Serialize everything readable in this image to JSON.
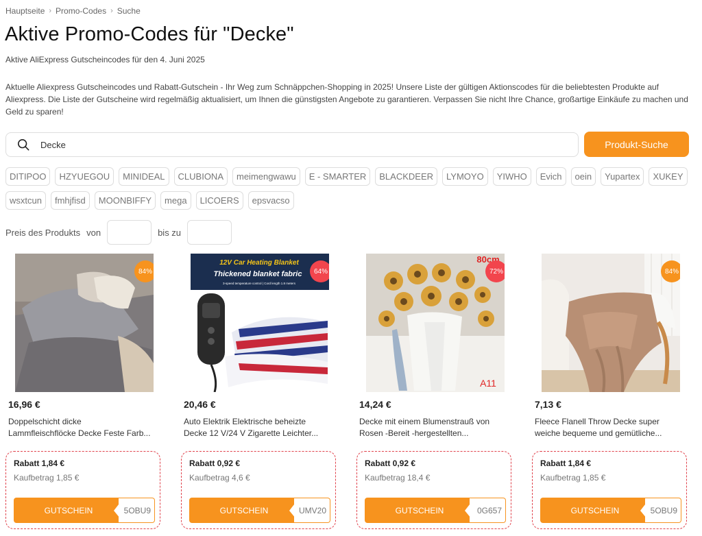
{
  "breadcrumb": [
    "Hauptseite",
    "Promo-Codes",
    "Suche"
  ],
  "page_title": "Aktive Promo-Codes für \"Decke\"",
  "subtitle": "Aktive AliExpress Gutscheincodes für den 4. Juni 2025",
  "description": "Aktuelle Aliexpress Gutscheincodes und Rabatt-Gutschein - Ihr Weg zum Schnäppchen-Shopping in 2025! Unsere Liste der gültigen Aktionscodes für die beliebtesten Produkte auf Aliexpress. Die Liste der Gutscheine wird regelmäßig aktualisiert, um Ihnen die günstigsten Angebote zu garantieren. Verpassen Sie nicht Ihre Chance, großartige Einkäufe zu machen und Geld zu sparen!",
  "search": {
    "value": "Decke",
    "button_label": "Produkt-Suche",
    "icon": "search-icon"
  },
  "tags": [
    "DITIPOO",
    "HZYUEGOU",
    "MINIDEAL",
    "CLUBIONA",
    "meimengwawu",
    "E - SMARTER",
    "BLACKDEER",
    "LYMOYO",
    "YIWHO",
    "Evich",
    "oein",
    "Yupartex",
    "XUKEY",
    "wsxtcun",
    "fmhjfisd",
    "MOONBIFFY",
    "mega",
    "LICOERS",
    "epsvacso"
  ],
  "price_filter": {
    "label": "Preis des Produkts",
    "from_label": "von",
    "to_label": "bis zu",
    "from_value": "",
    "to_value": ""
  },
  "colors": {
    "accent": "#f7931e",
    "badge_orange": "#f7931e",
    "badge_red": "#f2454d",
    "coupon_border": "#e0404a"
  },
  "products": [
    {
      "badge": "84%",
      "badge_color": "orange",
      "price": "16,96 €",
      "title_line1": "Doppelschicht dicke",
      "title_line2": "Lammfleischflöcke Decke Feste Farb...",
      "discount": "Rabatt 1,84 €",
      "min_purchase": "Kaufbetrag 1,85 €",
      "coupon_label": "GUTSCHEIN",
      "code_fragment": "5OBU9"
    },
    {
      "badge": "64%",
      "badge_color": "red",
      "image_text1": "12V Car Heating Blanket",
      "image_text2": "Thickened blanket fabric",
      "image_text3": "3-speed temperature control | Cord length 1.8 meters",
      "price": "20,46 €",
      "title_line1": "Auto Elektrik Elektrische beheizte",
      "title_line2": "Decke 12 V/24 V Zigarette Leichter...",
      "discount": "Rabatt 0,92 €",
      "min_purchase": "Kaufbetrag 4,6 €",
      "coupon_label": "GUTSCHEIN",
      "code_fragment": "UMV20"
    },
    {
      "badge": "72%",
      "badge_color": "red",
      "image_text1": "80cm",
      "image_text2": "A11",
      "price": "14,24 €",
      "title_line1": "Decke mit einem Blumenstrauß von",
      "title_line2": "Rosen -Bereit -hergestellten...",
      "discount": "Rabatt 0,92 €",
      "min_purchase": "Kaufbetrag 18,4 €",
      "coupon_label": "GUTSCHEIN",
      "code_fragment": "0G657"
    },
    {
      "badge": "84%",
      "badge_color": "orange",
      "price": "7,13 €",
      "title_line1": "Fleece Flanell Throw Decke super",
      "title_line2": "weiche bequeme und gemütliche...",
      "discount": "Rabatt 1,84 €",
      "min_purchase": "Kaufbetrag 1,85 €",
      "coupon_label": "GUTSCHEIN",
      "code_fragment": "5OBU9"
    }
  ]
}
